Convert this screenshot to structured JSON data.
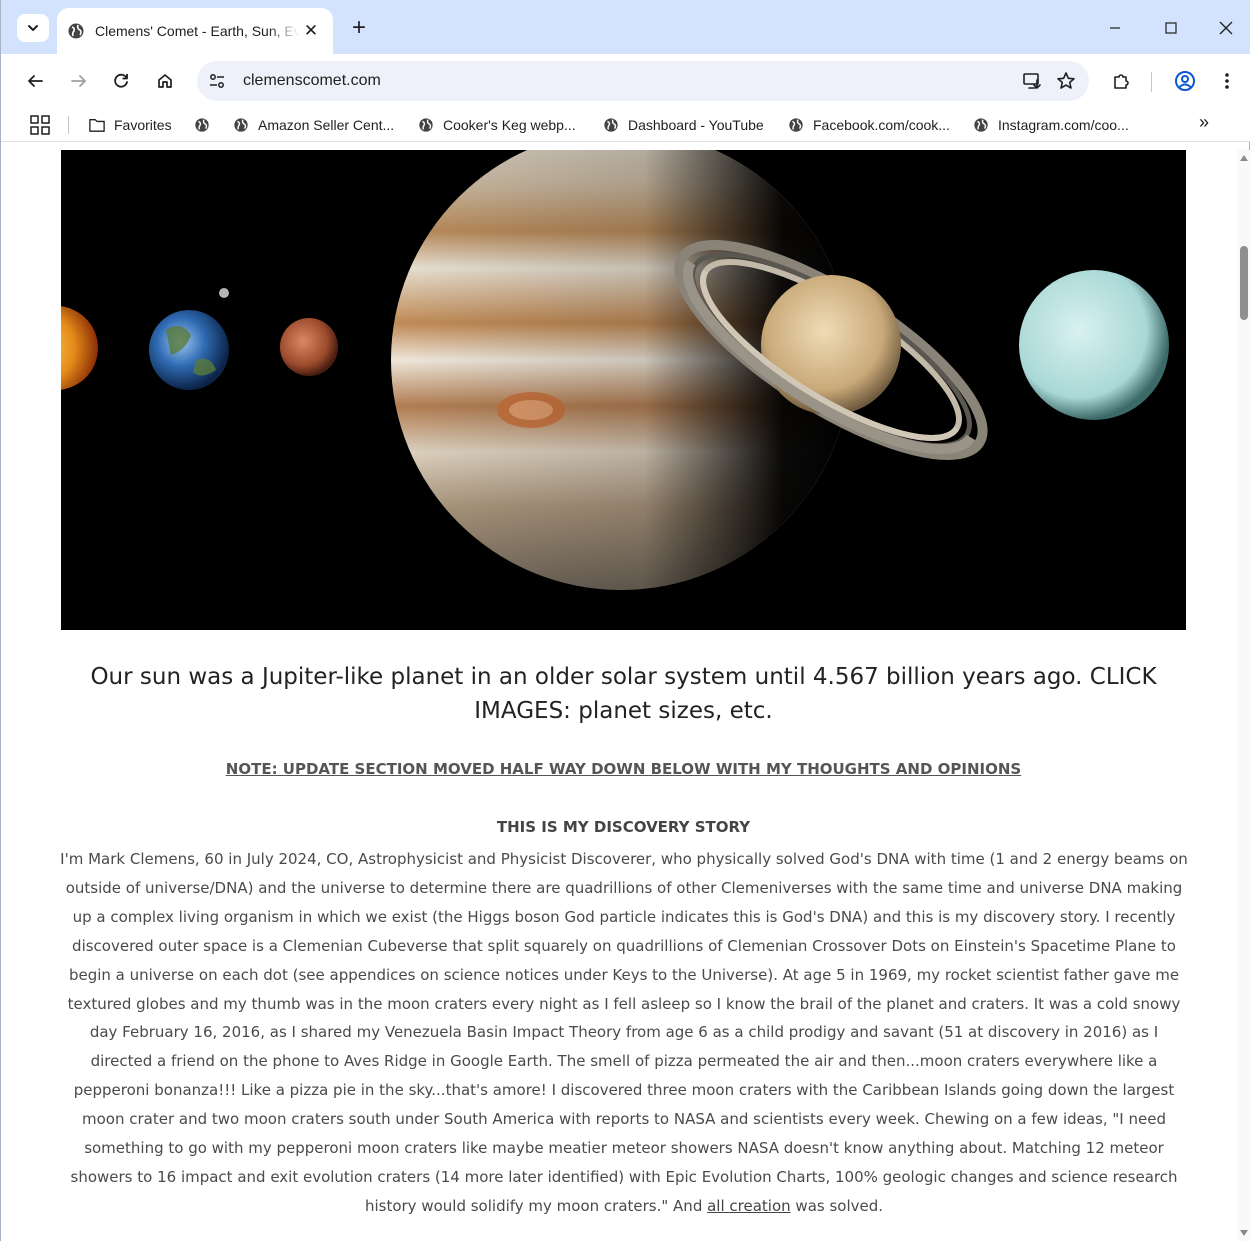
{
  "browser": {
    "tab_title": "Clemens' Comet - Earth, Sun, Ev",
    "url": "clemenscomet.com",
    "accent": "#d3e3fd"
  },
  "bookmarks": [
    {
      "label": "Favorites",
      "icon": "folder-icon"
    },
    {
      "label": "",
      "icon": "globe-icon"
    },
    {
      "label": "Amazon Seller Cent...",
      "icon": "globe-icon"
    },
    {
      "label": "Cooker's Keg webp...",
      "icon": "globe-icon"
    },
    {
      "label": "Dashboard - YouTube",
      "icon": "globe-icon"
    },
    {
      "label": "Facebook.com/cook...",
      "icon": "globe-icon"
    },
    {
      "label": "Instagram.com/coo...",
      "icon": "globe-icon"
    }
  ],
  "page": {
    "caption": "Our sun was a Jupiter-like planet in an older solar system until 4.567 billion years ago. CLICK IMAGES: planet sizes, etc.",
    "note": "NOTE: UPDATE SECTION MOVED HALF WAY DOWN BELOW WITH MY THOUGHTS AND OPINIONS",
    "story_heading": "THIS IS MY DISCOVERY STORY",
    "story_text": "I'm Mark Clemens, 60 in July 2024, CO, Astrophysicist and Physicist Discoverer, who physically solved God's DNA with time (1 and 2 energy beams on outside of universe/DNA) and the universe to determine there are quadrillions of other Clemeniverses with the same time and universe DNA making up a complex living organism in which we exist (the Higgs boson God particle indicates this is God's DNA) and this is my discovery story. I recently discovered outer space is a Clemenian Cubeverse that split squarely on quadrillions of Clemenian Crossover Dots on Einstein's Spacetime Plane to begin a universe on each dot (see appendices on science notices under Keys to the Universe). At age 5 in 1969, my rocket scientist father gave me textured globes and my thumb was in the moon craters every night as I fell asleep so I know the brail of the planet and craters. It was a cold snowy day February 16, 2016, as I shared my Venezuela Basin Impact Theory from age 6 as a child prodigy and savant (51 at discovery in 2016) as I directed a friend on the phone to Aves Ridge in Google Earth. The smell of pizza permeated the air and then...moon craters everywhere like a pepperoni bonanza!!!  Like a pizza pie in the sky...that's amore! I discovered three moon craters with the Caribbean Islands going down the largest moon crater and two moon craters south under South America with reports to NASA and scientists every week. Chewing on a few ideas, \"I need something to go with my pepperoni moon craters like maybe meatier meteor showers NASA doesn't know anything about. Matching 12 meteor showers to 16 impact and exit evolution craters (14 more later identified) with Epic Evolution Charts, 100% geologic changes and science research history would solidify my moon craters.\" And ",
    "story_link": "all creation",
    "story_end": " was solved."
  }
}
